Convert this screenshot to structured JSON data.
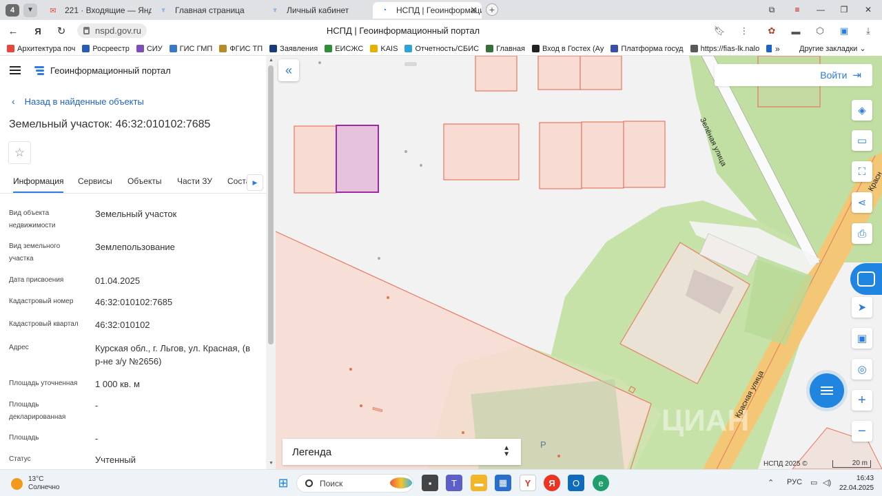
{
  "browser": {
    "tab_count": "4",
    "tabs": [
      {
        "label": "221 · Входящие — Яндекс",
        "icon": "mail-icon"
      },
      {
        "label": "Главная страница",
        "icon": "nalog-icon"
      },
      {
        "label": "Личный кабинет",
        "icon": "nalog-icon"
      },
      {
        "label": "НСПД | Геоинформацио",
        "icon": "nspd-icon",
        "active": true
      }
    ],
    "url": "nspd.gov.ru",
    "page_title": "НСПД | Геоинформационный портал",
    "bookmarks": [
      {
        "label": "Архитектура поч",
        "color": "#e8453c"
      },
      {
        "label": "Росреестр",
        "color": "#2a5bb5"
      },
      {
        "label": "СИУ",
        "color": "#7b4fb7"
      },
      {
        "label": "ГИС ГМП",
        "color": "#3a78c8"
      },
      {
        "label": "ФГИС ТП",
        "color": "#b58a2a"
      },
      {
        "label": "Заявления",
        "color": "#1a3b7a"
      },
      {
        "label": "ЕИСЖС",
        "color": "#2f8f3a"
      },
      {
        "label": "KAIS",
        "color": "#e6b000"
      },
      {
        "label": "Отчетность/СБИС",
        "color": "#2ea3d8"
      },
      {
        "label": "Главная",
        "color": "#3b6e3b"
      },
      {
        "label": "Вход в Гостех (Ау",
        "color": "#222222"
      },
      {
        "label": "Платформа госуд",
        "color": "#3a4fa8"
      },
      {
        "label": "https://fias-lk.nalo",
        "color": "#5a5a5a"
      },
      {
        "label": "E",
        "color": "#1f62c8"
      }
    ],
    "bookmarks_more": "»",
    "other_bookmarks": "Другие закладки"
  },
  "panel": {
    "portal_title": "Геоинформационный портал",
    "back_label": "Назад в найденные объекты",
    "heading": "Земельный участок: 46:32:010102:7685",
    "tabs": [
      "Информация",
      "Сервисы",
      "Объекты",
      "Части ЗУ",
      "Состав"
    ],
    "info": [
      {
        "key": "Вид объекта недвижимости",
        "value": "Земельный участок"
      },
      {
        "key": "Вид земельного участка",
        "value": "Землепользование"
      },
      {
        "key": "Дата присвоения",
        "value": "01.04.2025"
      },
      {
        "key": "Кадастровый номер",
        "value": "46:32:010102:7685"
      },
      {
        "key": "Кадастровый квартал",
        "value": "46:32:010102"
      },
      {
        "key": "Адрес",
        "value": "Курская обл., г. Льгов, ул. Красная, (в р-не з/у №2656)"
      },
      {
        "key": "Площадь уточненная",
        "value": "1 000 кв. м"
      },
      {
        "key": "Площадь декларированная",
        "value": "-"
      },
      {
        "key": "Площадь",
        "value": "-"
      },
      {
        "key": "Статус",
        "value": "Учтенный"
      }
    ]
  },
  "map": {
    "login_label": "Войти",
    "legend_label": "Легенда",
    "copyright": "НСПД 2025 ©",
    "scale": "20 m",
    "streets": [
      "Зелёная улица",
      "Красная улица",
      "Красн"
    ],
    "parcel_label": "Р",
    "watermark": "ЦИАН",
    "colors": {
      "selected_fill": "#e7c2dd",
      "selected_stroke": "#9c2aa5",
      "parcel_stroke": "#e8775f",
      "parcel_fill": "#f8dcd4",
      "green": "#c1dfa2",
      "road": "#f3c775",
      "accent": "#2d7be5"
    }
  },
  "taskbar": {
    "temp": "13°C",
    "weather": "Солнечно",
    "search_placeholder": "Поиск",
    "lang": "РУС",
    "time": "16:43",
    "date": "22.04.2025"
  }
}
